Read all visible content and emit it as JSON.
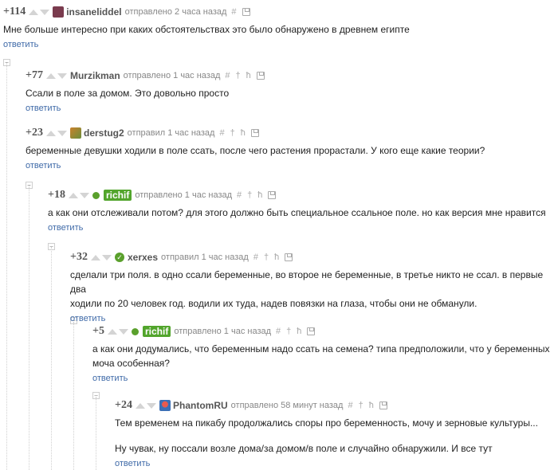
{
  "comments": [
    {
      "rating": "+114",
      "user": "insaneliddel",
      "meta": "отправлено 2 часа назад",
      "text": "Мне больше интересно при каких обстоятельствах это было обнаружено в древнем египте",
      "reply": "ответить"
    },
    {
      "rating": "+77",
      "user": "Murzikman",
      "meta": "отправлено 1 час назад",
      "text": "Ссали в поле за домом. Это довольно просто",
      "reply": "ответить"
    },
    {
      "rating": "+23",
      "user": "derstug2",
      "meta": "отправил 1 час назад",
      "text": "беременные девушки ходили в поле ссать, после чего растения прорастали. У кого еще какие теории?",
      "reply": "ответить"
    },
    {
      "rating": "+18",
      "user": "richif",
      "meta": "отправлено 1 час назад",
      "text": "а как они отслеживали потом? для этого должно быть специальное ссальное поле. но как версия мне нравится",
      "reply": "ответить"
    },
    {
      "rating": "+32",
      "user": "xerxes",
      "meta": "отправил 1 час назад",
      "text_lines": [
        "сделали три поля. в одно ссали беременные, во второе не беременные, в третье никто не ссал. в первые два",
        "ходили по 20 человек год. водили их туда, надев повязки на глаза, чтобы они не обманули."
      ],
      "reply": "ответить"
    },
    {
      "rating": "+5",
      "user": "richif",
      "meta": "отправлено 1 час назад",
      "text_lines": [
        "а как они додумались, что беременным надо ссать на семена? типа предположили, что у беременных",
        "моча особенная?"
      ],
      "reply": "ответить"
    },
    {
      "rating": "+24",
      "user": "PhantomRU",
      "meta": "отправлено 58 минут назад",
      "text_lines": [
        "Тем временем на пикабу продолжались споры про беременность, мочу и зерновые культуры...",
        "Ну чувак, ну поссали возле дома/за домом/в поле и случайно обнаружили. И все тут"
      ],
      "reply": "ответить"
    }
  ],
  "tools": {
    "hash": "#",
    "up": "†",
    "branch": "ħ"
  },
  "collapse_glyph": "−",
  "verified_glyph": "✓"
}
